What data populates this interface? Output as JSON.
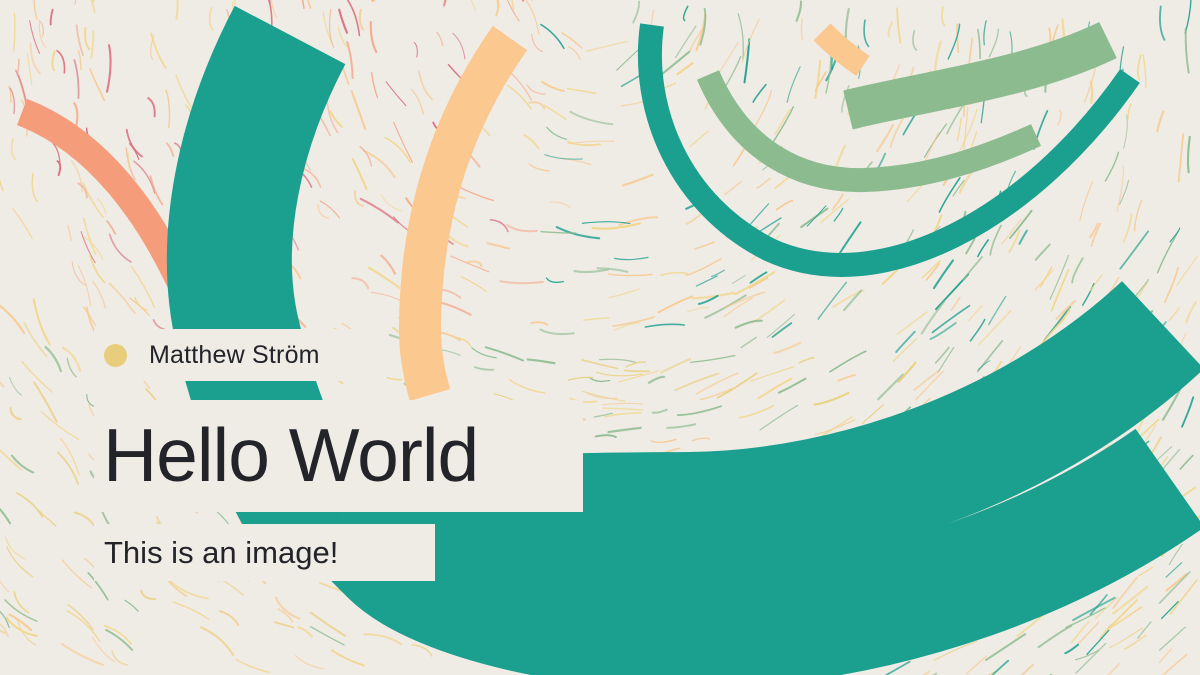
{
  "card": {
    "author": "Matthew Ström",
    "title": "Hello World",
    "subtitle": "This is an image!"
  },
  "colors": {
    "background": "#efebe5",
    "teal": "#1b9f8e",
    "peach": "#fbc890",
    "salmon": "#f59c7b",
    "sage": "#8bbb8e",
    "gold": "#e8cd7c",
    "text": "#23232a"
  },
  "icons": {
    "author_avatar": "circle-dot-icon"
  }
}
